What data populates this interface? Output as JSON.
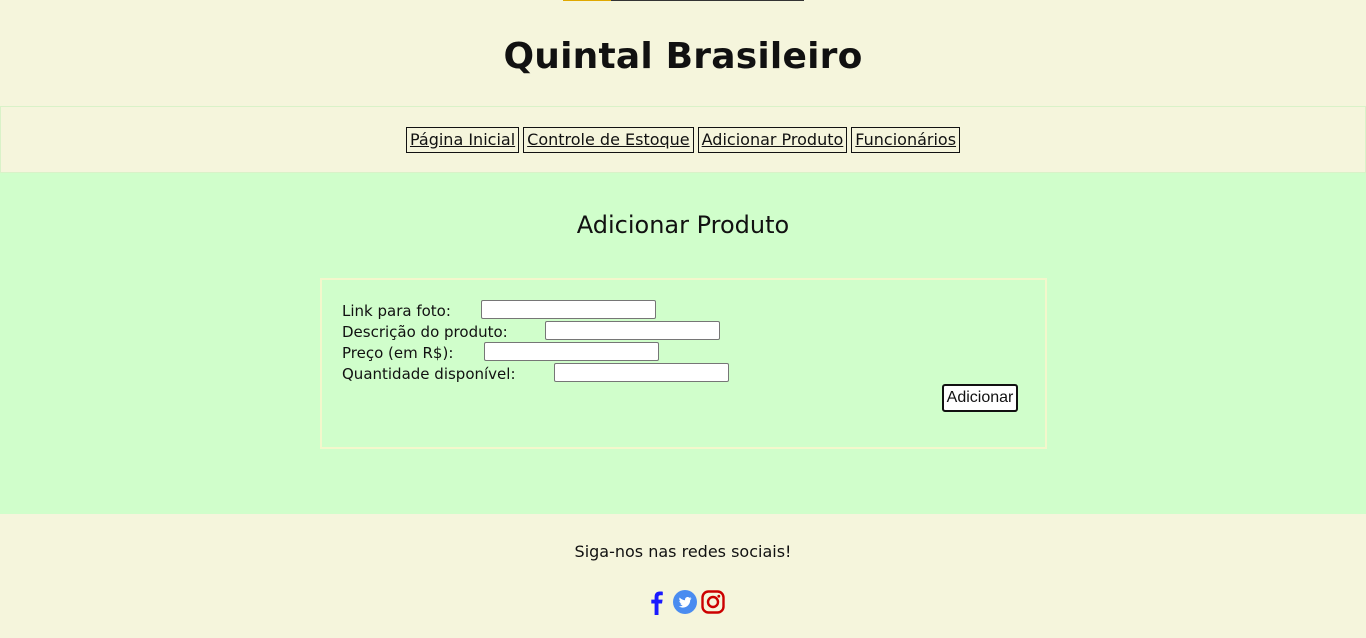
{
  "header": {
    "title": "Quintal Brasileiro"
  },
  "nav": {
    "items": [
      {
        "label": "Página Inicial"
      },
      {
        "label": "Controle de Estoque"
      },
      {
        "label": "Adicionar Produto"
      },
      {
        "label": "Funcionários"
      }
    ]
  },
  "main": {
    "title": "Adicionar Produto",
    "form": {
      "fields": [
        {
          "label": "Link para foto:",
          "value": ""
        },
        {
          "label": "Descrição do produto:",
          "value": ""
        },
        {
          "label": "Preço (em R$):",
          "value": ""
        },
        {
          "label": "Quantidade disponível:",
          "value": ""
        }
      ],
      "submit_label": "Adicionar"
    }
  },
  "footer": {
    "text": "Siga-nos nas redes sociais!",
    "social": [
      {
        "icon": "facebook-icon",
        "color": "#1a1aff"
      },
      {
        "icon": "twitter-icon",
        "color": "#4a8cf0"
      },
      {
        "icon": "instagram-icon",
        "color": "#cc0000"
      }
    ]
  },
  "colors": {
    "background": "#f5f5dc",
    "main_background": "#d0fecb",
    "logo_accent": "#e0a800"
  }
}
